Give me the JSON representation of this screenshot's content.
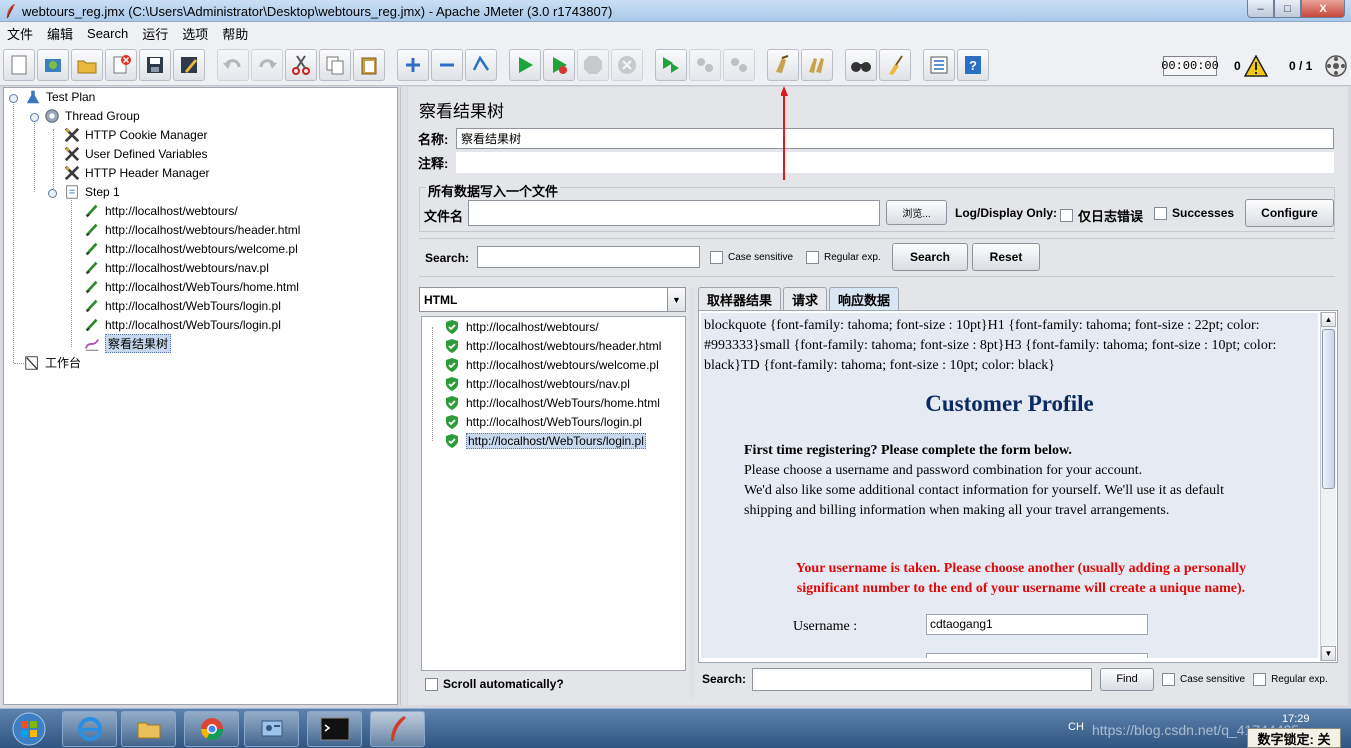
{
  "window": {
    "title": "webtours_reg.jmx (C:\\Users\\Administrator\\Desktop\\webtours_reg.jmx) - Apache JMeter (3.0 r1743807)",
    "min_label": "–",
    "max_label": "□",
    "close_label": "X"
  },
  "menu": [
    "文件",
    "编辑",
    "Search",
    "运行",
    "选项",
    "帮助"
  ],
  "toolbar": {
    "icons": [
      "new-icon",
      "templates-icon",
      "open-icon",
      "close-icon",
      "save-icon",
      "save-as-icon",
      "undo-icon",
      "redo-icon",
      "cut-icon",
      "copy-icon",
      "paste-icon",
      "expand-icon",
      "collapse-icon",
      "toggle-icon",
      "start-icon",
      "start-no-pause-icon",
      "stop-icon",
      "shutdown-icon",
      "remote-start-icon",
      "remote-stop-icon",
      "remote-shutdown-icon",
      "clear-icon",
      "clear-all-icon",
      "search-icon",
      "reset-search-icon",
      "function-helper-icon",
      "help-icon"
    ],
    "timer": "00:00:00",
    "warnings": "0",
    "threads": "0 / 1"
  },
  "tree": {
    "items": [
      {
        "label": "Test Plan",
        "icon": "test-plan-icon"
      },
      {
        "label": "Thread Group",
        "icon": "thread-group-icon"
      },
      {
        "label": "HTTP Cookie Manager",
        "icon": "config-tool-icon"
      },
      {
        "label": "User Defined Variables",
        "icon": "config-tool-icon"
      },
      {
        "label": "HTTP Header Manager",
        "icon": "config-tool-icon"
      },
      {
        "label": "Step 1",
        "icon": "controller-icon"
      },
      {
        "label": "http://localhost/webtours/",
        "icon": "sampler-icon"
      },
      {
        "label": "http://localhost/webtours/header.html",
        "icon": "sampler-icon"
      },
      {
        "label": "http://localhost/webtours/welcome.pl",
        "icon": "sampler-icon"
      },
      {
        "label": "http://localhost/webtours/nav.pl",
        "icon": "sampler-icon"
      },
      {
        "label": "http://localhost/WebTours/home.html",
        "icon": "sampler-icon"
      },
      {
        "label": "http://localhost/WebTours/login.pl",
        "icon": "sampler-icon"
      },
      {
        "label": "http://localhost/WebTours/login.pl",
        "icon": "sampler-icon"
      },
      {
        "label": "察看结果树",
        "icon": "listener-icon"
      },
      {
        "label": "工作台",
        "icon": "workbench-icon"
      }
    ]
  },
  "panel": {
    "title": "察看结果树",
    "name_label": "名称:",
    "name_value": "察看结果树",
    "comment_label": "注释:",
    "comment_value": "",
    "file_group_title": "所有数据写入一个文件",
    "filename_label": "文件名",
    "filename_value": "",
    "browse_label": "浏览...",
    "log_display_label": "Log/Display Only:",
    "errors_only_label": "仅日志错误",
    "successes_label": "Successes",
    "configure_label": "Configure",
    "search_label": "Search:",
    "search_value": "",
    "case_sensitive_label": "Case sensitive",
    "regex_label": "Regular exp.",
    "search_button": "Search",
    "reset_button": "Reset"
  },
  "results": {
    "renderer": "HTML",
    "items": [
      "http://localhost/webtours/",
      "http://localhost/webtours/header.html",
      "http://localhost/webtours/welcome.pl",
      "http://localhost/webtours/nav.pl",
      "http://localhost/WebTours/home.html",
      "http://localhost/WebTours/login.pl",
      "http://localhost/WebTours/login.pl"
    ],
    "scroll_auto_label": "Scroll automatically?",
    "tabs": [
      "取样器结果",
      "请求",
      "响应数据"
    ],
    "response": {
      "css_dump": "blockquote {font-family: tahoma; font-size : 10pt}H1 {font-family: tahoma; font-size : 22pt; color: #993333}small {font-family: tahoma; font-size : 8pt}H3 {font-family: tahoma; font-size : 10pt; color: black}TD {font-family: tahoma; font-size : 10pt; color: black}",
      "heading": "Customer Profile",
      "lead_bold": "First time registering? Please complete the form below.",
      "lead_line1": "Please choose a username and password combination for your account.",
      "lead_line2": "We'd also like some additional contact information for yourself. We'll use it as default",
      "lead_line3": "shipping and billing information when making all your travel arrangements.",
      "error_line1": "Your username is taken. Please choose another (usually adding a personally",
      "error_line2": "significant number to the end of your username will create a unique name).",
      "username_label": "Username :",
      "username_value": "cdtaogang1"
    },
    "bottom_search_label": "Search:",
    "find_button": "Find",
    "case_sensitive_label": "Case sensitive",
    "regex_label": "Regular exp."
  },
  "taskbar": {
    "ime": "CH",
    "clock": "17:29",
    "watermark": "https://blog.csdn.net/q_41744425",
    "numlock": "数字锁定: 关"
  }
}
